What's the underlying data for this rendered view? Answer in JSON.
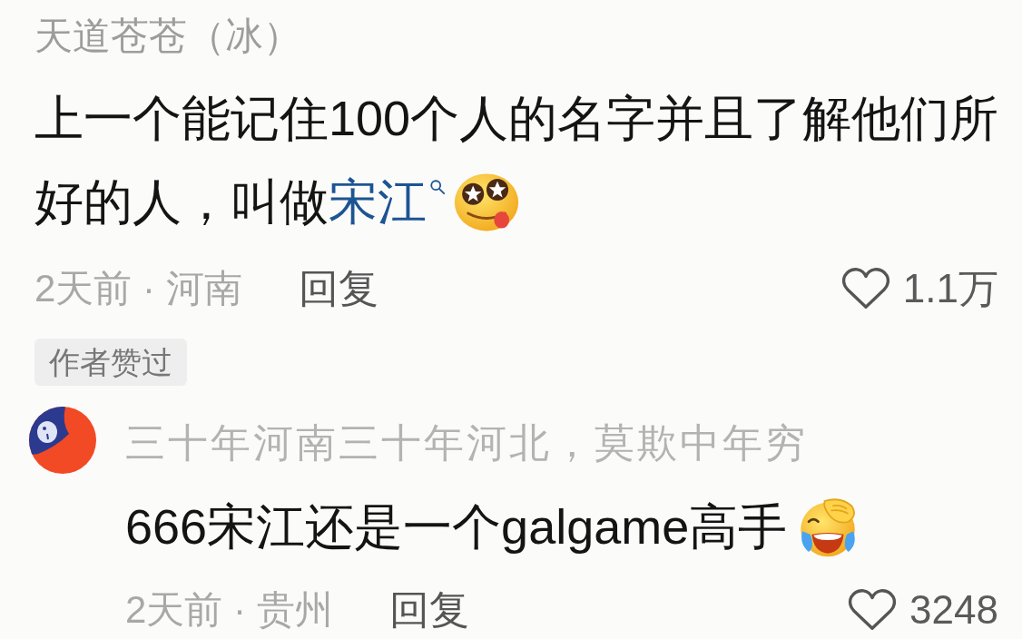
{
  "comments": [
    {
      "author": "天道苍苍（冰）",
      "lines": [
        [
          {
            "kind": "text",
            "text": "上一个能记住100个人的名字并且了解他们所"
          }
        ],
        [
          {
            "kind": "text",
            "text": "好的人，叫做"
          },
          {
            "kind": "link",
            "text": "宋江"
          },
          {
            "kind": "emoji"
          }
        ]
      ],
      "time_location": "2天前 · 河南",
      "reply_button": "回复",
      "liked": false,
      "likes": "1.1万",
      "badge": "作者赞过",
      "replies": [
        {
          "author": "三十年河南三十年河北，莫欺中年穷",
          "lines": [
            [
              {
                "kind": "text",
                "text": "666宋江还是一个galgame高手"
              },
              {
                "kind": "emoji"
              }
            ]
          ],
          "time_location": "2天前 · 贵州",
          "reply_button": "回复",
          "liked": false,
          "likes": "3248"
        }
      ]
    }
  ]
}
